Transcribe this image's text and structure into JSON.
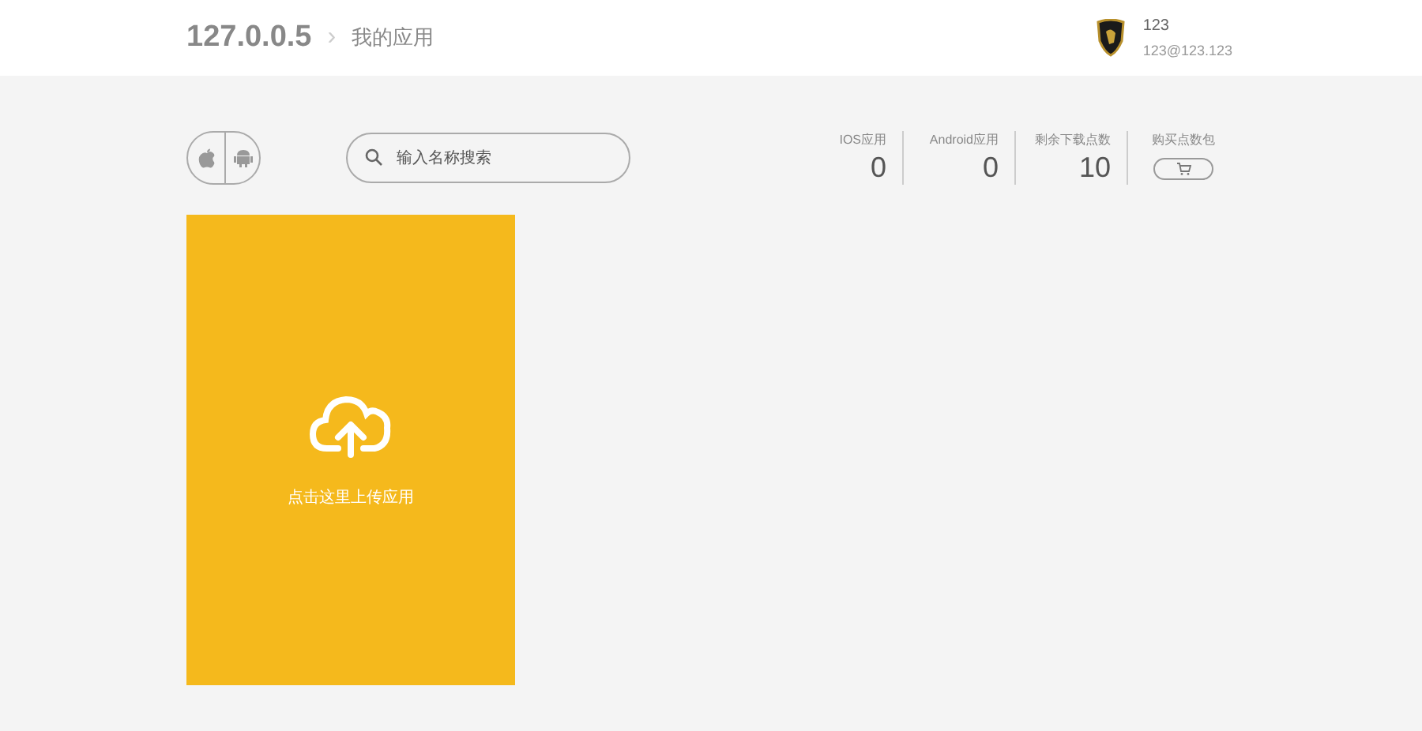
{
  "header": {
    "site": "127.0.0.5",
    "separator": "›",
    "page": "我的应用",
    "user": {
      "name": "123",
      "email": "123@123.123"
    }
  },
  "toolbar": {
    "search": {
      "placeholder": "输入名称搜索"
    },
    "stats": [
      {
        "kind": "count",
        "label": "IOS应用",
        "value": "0"
      },
      {
        "kind": "count",
        "label": "Android应用",
        "value": "0"
      },
      {
        "kind": "count",
        "label": "剩余下载点数",
        "value": "10"
      },
      {
        "kind": "buy",
        "label": "购买点数包"
      }
    ]
  },
  "upload_card": {
    "label": "点击这里上传应用"
  }
}
